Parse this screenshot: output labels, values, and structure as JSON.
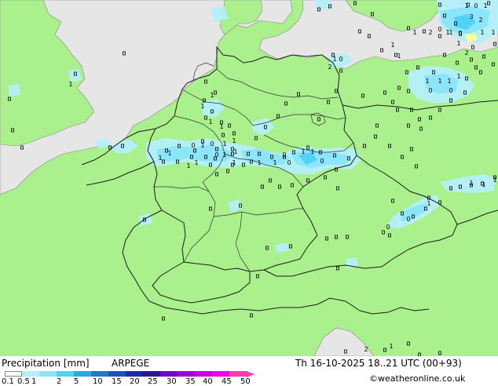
{
  "footer": {
    "label": "Precipitation [mm]",
    "model": "ARPEGE",
    "datetime": "Th 16-10-2025 18..21 UTC (00+93)",
    "credit": "©weatheronline.co.uk"
  },
  "legend": {
    "ticks": [
      "0.1",
      "0.5",
      "1",
      "2",
      "5",
      "10",
      "15",
      "20",
      "25",
      "30",
      "35",
      "40",
      "45",
      "50"
    ],
    "colors": [
      "#f5fffa",
      "#b4f0fa",
      "#8be6fa",
      "#50d2f5",
      "#28aae6",
      "#1e78d2",
      "#1e50be",
      "#1e28aa",
      "#321496",
      "#7800c8",
      "#a000d2",
      "#c800dc",
      "#f000e6",
      "#ff3cb4"
    ]
  },
  "map": {
    "land_color": "#aaf08c",
    "sea_color": "#e6e6e6",
    "rain_light_color": "#b4f0fa",
    "rain_mid_color": "#8be6fa",
    "rain_heavy_color": "#50d2f5",
    "highlight_color": "#ffff96",
    "value_labels": [
      "1",
      "0",
      "1",
      "2",
      "3",
      "1",
      "1",
      "0",
      "1",
      "2",
      "1",
      "1",
      "2",
      "1",
      "1",
      "0",
      "1",
      "2",
      "1",
      "1",
      "1",
      "1",
      "1",
      "1",
      "1",
      "0",
      "1",
      "0",
      "0",
      "1",
      "1",
      "1",
      "1",
      "1",
      "0",
      "1",
      "1",
      "0",
      "0",
      "1",
      "1",
      "1",
      "1",
      "0",
      "1",
      "0",
      "1",
      "1",
      "1",
      "0",
      "1",
      "1",
      "1",
      "1",
      "0",
      "0",
      "1",
      "2",
      "1"
    ]
  }
}
